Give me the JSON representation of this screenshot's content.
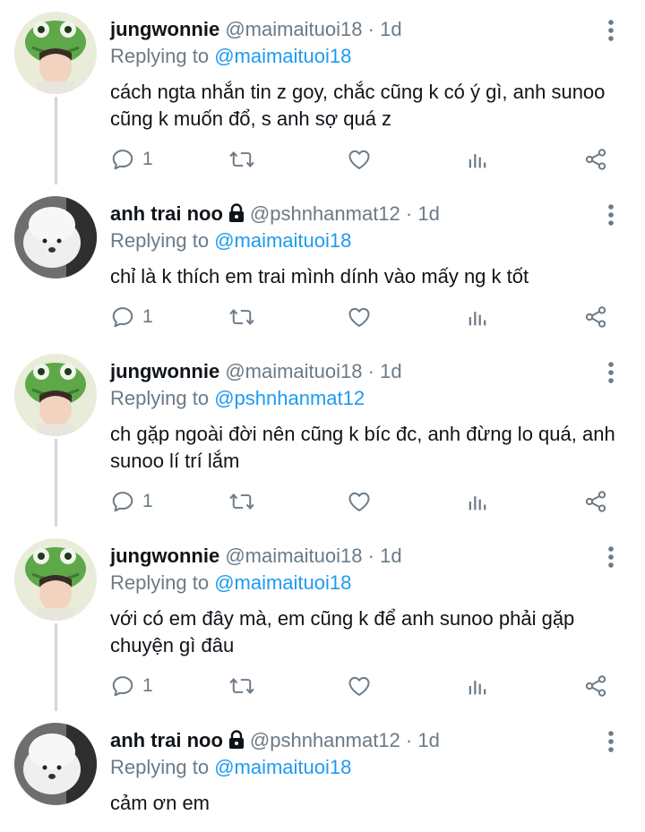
{
  "tweets": [
    {
      "name": "jungwonnie",
      "handle": "@maimaituoi18",
      "time": "· 1d",
      "replying_prefix": "Replying to",
      "replying_to": "@maimaituoi18",
      "text": "cách ngta nhắn tin z goy, chắc cũng k có ý gì, anh sunoo cũng k muốn đổ, s anh sợ quá z",
      "reply_count": "1",
      "avatar": "green-frog-hat-avatar",
      "locked": false
    },
    {
      "name": "anh trai noo",
      "handle": "@pshnhanmat12",
      "time": "· 1d",
      "replying_prefix": "Replying to",
      "replying_to": "@maimaituoi18",
      "text": "chỉ là k thích em trai mình dính vào mấy ng k tốt",
      "reply_count": "1",
      "avatar": "white-dog-avatar",
      "locked": true
    },
    {
      "name": "jungwonnie",
      "handle": "@maimaituoi18",
      "time": "· 1d",
      "replying_prefix": "Replying to",
      "replying_to": "@pshnhanmat12",
      "text": "ch gặp ngoài đời nên cũng k bíc đc, anh đừng lo quá, anh sunoo lí trí lắm",
      "reply_count": "1",
      "avatar": "green-frog-hat-avatar",
      "locked": false
    },
    {
      "name": "jungwonnie",
      "handle": "@maimaituoi18",
      "time": "· 1d",
      "replying_prefix": "Replying to",
      "replying_to": "@maimaituoi18",
      "text": "với có em đây mà, em cũng k để anh sunoo phải gặp chuyện gì đâu",
      "reply_count": "1",
      "avatar": "green-frog-hat-avatar",
      "locked": false
    },
    {
      "name": "anh trai noo",
      "handle": "@pshnhanmat12",
      "time": "· 1d",
      "replying_prefix": "Replying to",
      "replying_to": "@maimaituoi18",
      "text": "cảm ơn em",
      "reply_count": "",
      "avatar": "white-dog-avatar",
      "locked": true
    }
  ],
  "colors": {
    "link": "#1d9bf0",
    "meta": "#6b7a86",
    "thread_line": "#d0d7dd"
  }
}
